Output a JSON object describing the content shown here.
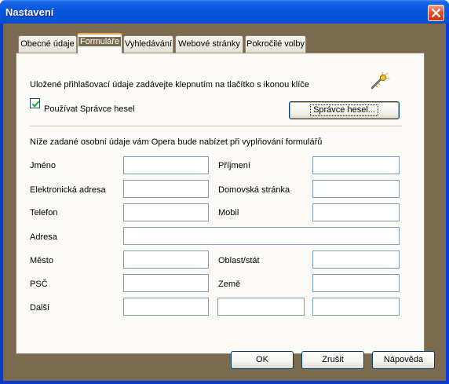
{
  "window": {
    "title": "Nastavení"
  },
  "tabs": [
    {
      "label": "Obecné údaje",
      "active": false
    },
    {
      "label": "Formuláře",
      "active": true
    },
    {
      "label": "Vyhledávání",
      "active": false
    },
    {
      "label": "Webové stránky",
      "active": false
    },
    {
      "label": "Pokročilé volby",
      "active": false
    }
  ],
  "forms": {
    "info_text": "Uložené přihlašovací údaje zadávejte klepnutím na tlačítko s ikonou klíče",
    "key_icon": "wand-key-icon",
    "password_manager_checkbox": {
      "label": "Používat Správce hesel",
      "checked": true
    },
    "password_manager_button": "Správce hesel...",
    "personal_info_text": "Níže zadané osobní údaje vám Opera bude nabízet při vyplňování formulářů",
    "fields": {
      "first_name": {
        "label": "Jméno",
        "value": ""
      },
      "last_name": {
        "label": "Příjmení",
        "value": ""
      },
      "email": {
        "label": "Elektronická adresa",
        "value": ""
      },
      "homepage": {
        "label": "Domovská stránka",
        "value": ""
      },
      "phone": {
        "label": "Telefon",
        "value": ""
      },
      "mobile": {
        "label": "Mobil",
        "value": ""
      },
      "address": {
        "label": "Adresa",
        "value": ""
      },
      "city": {
        "label": "Město",
        "value": ""
      },
      "state": {
        "label": "Oblast/stát",
        "value": ""
      },
      "zip": {
        "label": "PSČ",
        "value": ""
      },
      "country": {
        "label": "Země",
        "value": ""
      },
      "other": {
        "label": "Další",
        "values": [
          "",
          "",
          ""
        ]
      }
    }
  },
  "footer": {
    "ok": "OK",
    "cancel": "Zrušit",
    "help": "Nápověda"
  },
  "colors": {
    "titlebar": "#0855dd",
    "dialog_background": "#7a6a50",
    "panel_background": "#fbfaf6",
    "active_tab_highlight": "#f2a84a",
    "close_button": "#e0522f"
  }
}
